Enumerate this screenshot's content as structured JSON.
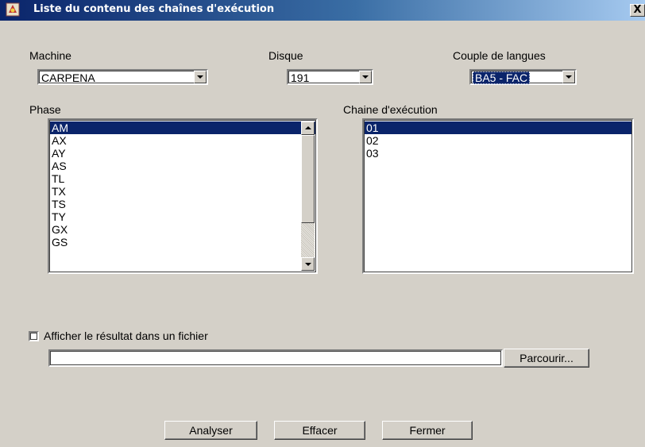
{
  "window": {
    "title": "Liste du contenu des chaînes d'exécution",
    "close_label": "X"
  },
  "machine": {
    "label": "Machine",
    "value": "CARPENA"
  },
  "disque": {
    "label": "Disque",
    "value": "191"
  },
  "couple": {
    "label": "Couple de langues",
    "value": "BA5 - FAC"
  },
  "phase": {
    "label": "Phase",
    "items": [
      "AM",
      "AX",
      "AY",
      "AS",
      "TL",
      "TX",
      "TS",
      "TY",
      "GX",
      "GS"
    ],
    "selected": "AM"
  },
  "chaine": {
    "label": "Chaine d'exécution",
    "items": [
      "01",
      "02",
      "03"
    ],
    "selected": "01"
  },
  "output": {
    "checkbox_label": "Afficher le résultat dans un fichier",
    "checked": false,
    "file_path": "",
    "browse_label": "Parcourir..."
  },
  "actions": {
    "analyser": "Analyser",
    "effacer": "Effacer",
    "fermer": "Fermer"
  },
  "colors": {
    "selection": "#0a246a",
    "dialog_bg": "#d4d0c8"
  }
}
